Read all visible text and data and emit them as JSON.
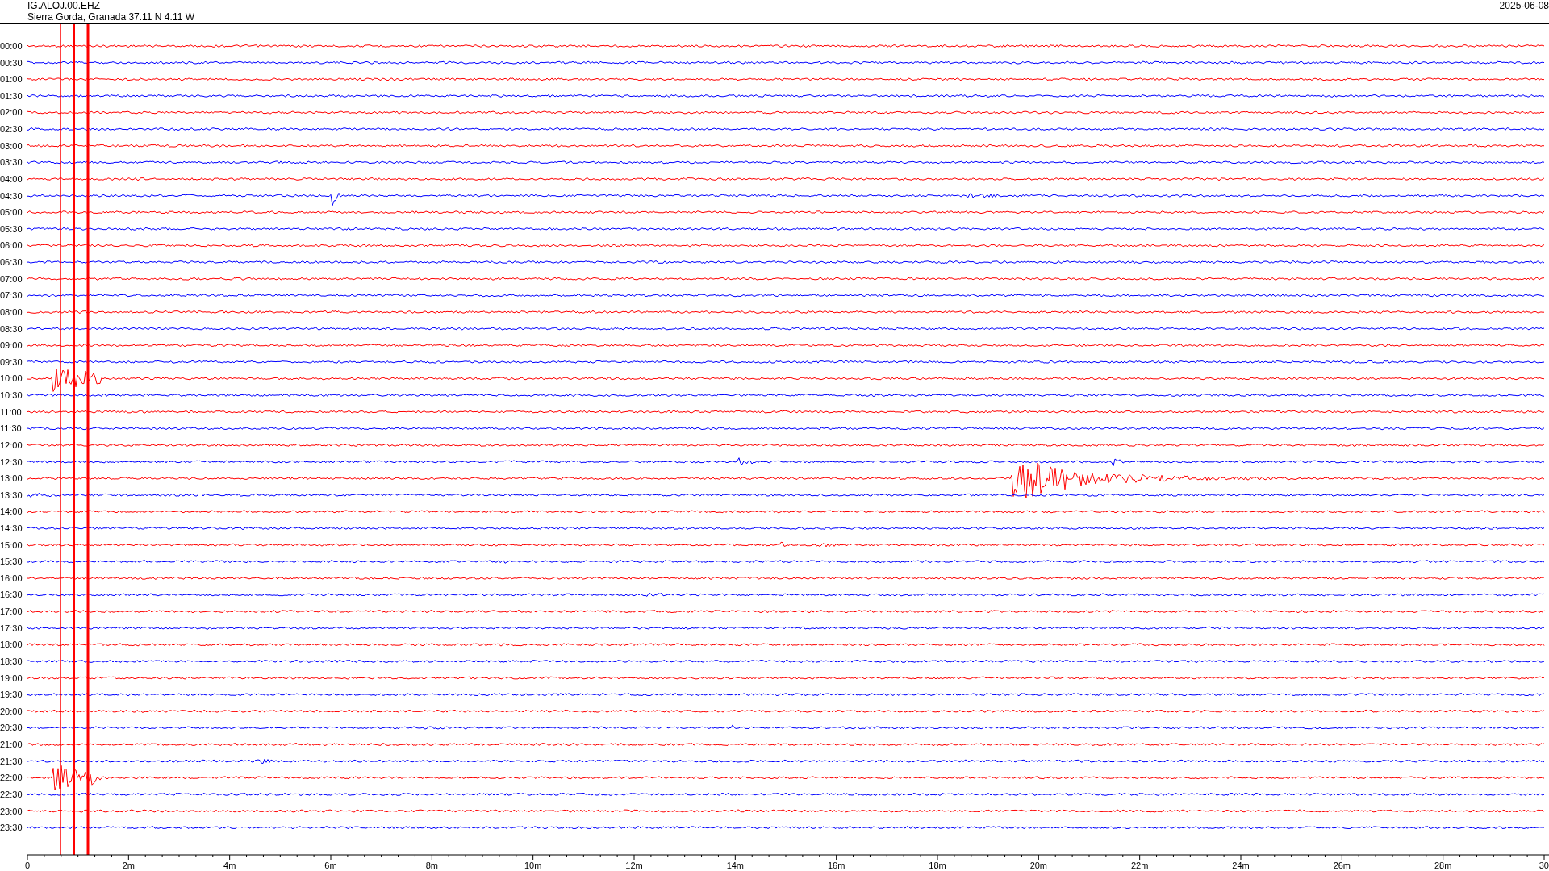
{
  "header": {
    "station": "IG.ALOJ.00.EHZ",
    "location": "Sierra Gorda, Granada  37.11 N 4.11 W",
    "date": "2025-06-08"
  },
  "rows": [
    {
      "label": "00:00",
      "color": "#ff0000"
    },
    {
      "label": "00:30",
      "color": "#0000ff"
    },
    {
      "label": "01:00",
      "color": "#ff0000"
    },
    {
      "label": "01:30",
      "color": "#0000ff"
    },
    {
      "label": "02:00",
      "color": "#ff0000"
    },
    {
      "label": "02:30",
      "color": "#0000ff"
    },
    {
      "label": "03:00",
      "color": "#ff0000"
    },
    {
      "label": "03:30",
      "color": "#0000ff"
    },
    {
      "label": "04:00",
      "color": "#ff0000"
    },
    {
      "label": "04:30",
      "color": "#0000ff"
    },
    {
      "label": "05:00",
      "color": "#ff0000"
    },
    {
      "label": "05:30",
      "color": "#0000ff"
    },
    {
      "label": "06:00",
      "color": "#ff0000"
    },
    {
      "label": "06:30",
      "color": "#0000ff"
    },
    {
      "label": "07:00",
      "color": "#ff0000"
    },
    {
      "label": "07:30",
      "color": "#0000ff"
    },
    {
      "label": "08:00",
      "color": "#ff0000"
    },
    {
      "label": "08:30",
      "color": "#0000ff"
    },
    {
      "label": "09:00",
      "color": "#ff0000"
    },
    {
      "label": "09:30",
      "color": "#0000ff"
    },
    {
      "label": "10:00",
      "color": "#ff0000"
    },
    {
      "label": "10:30",
      "color": "#0000ff"
    },
    {
      "label": "11:00",
      "color": "#ff0000"
    },
    {
      "label": "11:30",
      "color": "#0000ff"
    },
    {
      "label": "12:00",
      "color": "#ff0000"
    },
    {
      "label": "12:30",
      "color": "#0000ff"
    },
    {
      "label": "13:00",
      "color": "#ff0000"
    },
    {
      "label": "13:30",
      "color": "#0000ff"
    },
    {
      "label": "14:00",
      "color": "#ff0000"
    },
    {
      "label": "14:30",
      "color": "#0000ff"
    },
    {
      "label": "15:00",
      "color": "#ff0000"
    },
    {
      "label": "15:30",
      "color": "#0000ff"
    },
    {
      "label": "16:00",
      "color": "#ff0000"
    },
    {
      "label": "16:30",
      "color": "#0000ff"
    },
    {
      "label": "17:00",
      "color": "#ff0000"
    },
    {
      "label": "17:30",
      "color": "#0000ff"
    },
    {
      "label": "18:00",
      "color": "#ff0000"
    },
    {
      "label": "18:30",
      "color": "#0000ff"
    },
    {
      "label": "19:00",
      "color": "#ff0000"
    },
    {
      "label": "19:30",
      "color": "#0000ff"
    },
    {
      "label": "20:00",
      "color": "#ff0000"
    },
    {
      "label": "20:30",
      "color": "#0000ff"
    },
    {
      "label": "21:00",
      "color": "#ff0000"
    },
    {
      "label": "21:30",
      "color": "#0000ff"
    },
    {
      "label": "22:00",
      "color": "#ff0000"
    },
    {
      "label": "22:30",
      "color": "#0000ff"
    },
    {
      "label": "23:00",
      "color": "#ff0000"
    },
    {
      "label": "23:30",
      "color": "#0000ff"
    }
  ],
  "x_axis": {
    "tick_labels": [
      "0",
      "2m",
      "4m",
      "6m",
      "8m",
      "10m",
      "12m",
      "14m",
      "16m",
      "18m",
      "20m",
      "22m",
      "24m",
      "26m",
      "28m",
      "30"
    ]
  }
}
